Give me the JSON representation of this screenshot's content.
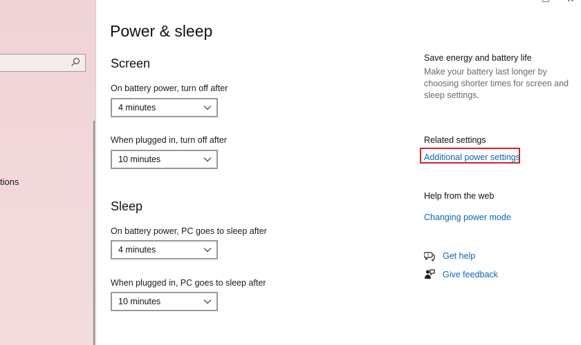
{
  "sidebar": {
    "visible_item_text": "tions"
  },
  "window": {
    "minimize_glyph": "–",
    "maximize_glyph": "☐",
    "close_glyph": "✕"
  },
  "page": {
    "title": "Power & sleep"
  },
  "screen": {
    "title": "Screen",
    "battery_label": "On battery power, turn off after",
    "battery_value": "4 minutes",
    "plugged_label": "When plugged in, turn off after",
    "plugged_value": "10 minutes"
  },
  "sleep": {
    "title": "Sleep",
    "battery_label": "On battery power, PC goes to sleep after",
    "battery_value": "4 minutes",
    "plugged_label": "When plugged in, PC goes to sleep after",
    "plugged_value": "10 minutes"
  },
  "right": {
    "save_heading": "Save energy and battery life",
    "save_text": "Make your battery last longer by choosing shorter times for screen and sleep settings.",
    "related_heading": "Related settings",
    "related_link": "Additional power settings",
    "help_heading": "Help from the web",
    "help_link": "Changing power mode",
    "get_help": "Get help",
    "give_feedback": "Give feedback"
  },
  "colors": {
    "link": "#0b67b3",
    "highlight": "#d62222",
    "sidebar_bg": "#f0d5d7"
  },
  "icons": {
    "search": "search-icon",
    "chevron": "chevron-down-icon",
    "get_help": "help-chat-icon",
    "feedback": "feedback-icon"
  }
}
